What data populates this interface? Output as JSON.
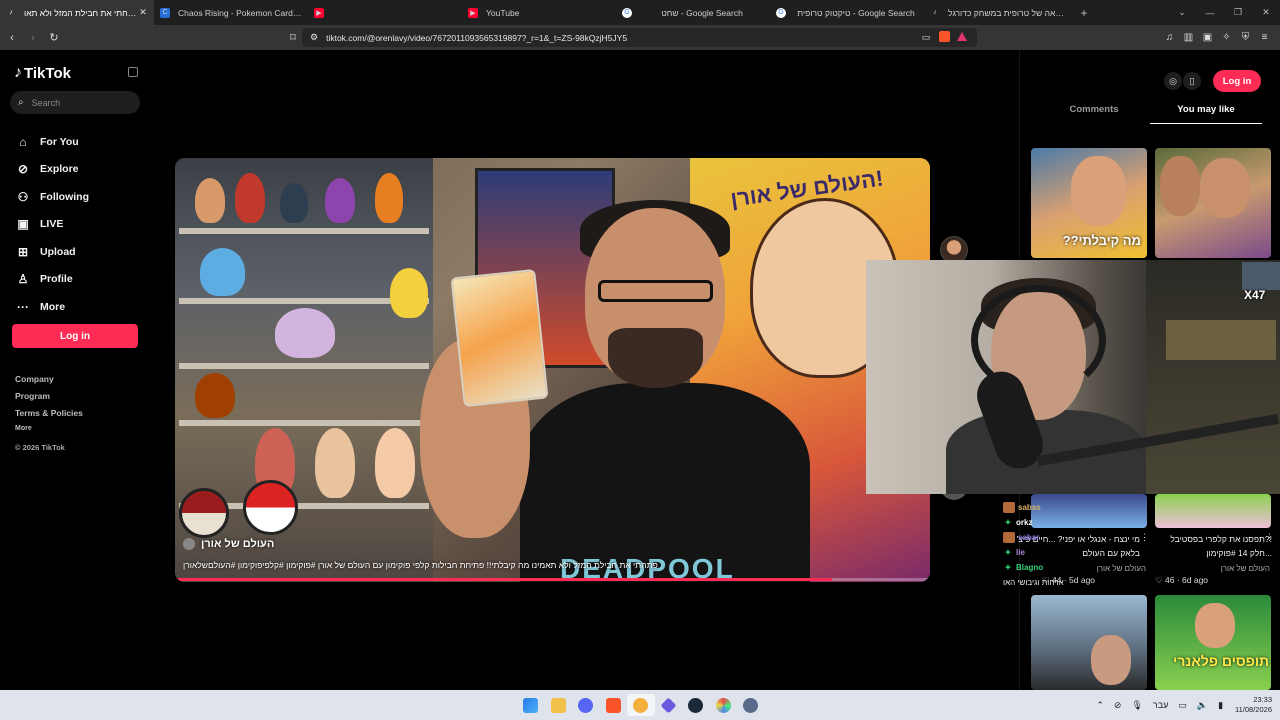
{
  "browser": {
    "tabs": [
      {
        "title": "פתחתי את חבילת המזל ולא תאו",
        "icon": "tiktok-icon",
        "active": true
      },
      {
        "title": "Chaos Rising - Pokemon Card List an",
        "icon": "page-icon",
        "active": false
      },
      {
        "title": "",
        "icon": "youtube-icon",
        "active": false
      },
      {
        "title": "YouTube",
        "icon": "youtube-icon",
        "active": false
      },
      {
        "title": "שחט - Google Search",
        "icon": "google-icon",
        "active": false
      },
      {
        "title": "טיקטוק טרופית - Google Search",
        "icon": "google-icon",
        "active": false
      },
      {
        "title": "ההוצאה של טרופית במשחק כדורגל |",
        "icon": "tiktok-icon",
        "active": false
      }
    ],
    "new_tab": "+",
    "url": "tiktok.com/@orenlavy/video/7672011093565319897?_r=1&_t=ZS-98kQzjH5JY5"
  },
  "sidebar": {
    "brand": "TikTok",
    "search_placeholder": "Search",
    "menu": [
      {
        "label": "For You",
        "icon": "home-icon"
      },
      {
        "label": "Explore",
        "icon": "compass-icon"
      },
      {
        "label": "Following",
        "icon": "people-icon"
      },
      {
        "label": "LIVE",
        "icon": "live-icon"
      },
      {
        "label": "Upload",
        "icon": "plus-square-icon"
      },
      {
        "label": "Profile",
        "icon": "person-icon"
      },
      {
        "label": "More",
        "icon": "more-dots-icon"
      }
    ],
    "login_label": "Log in",
    "footer": [
      "Company",
      "Program",
      "Terms & Policies"
    ],
    "footer_more": "More",
    "copyright": "© 2026 TikTok"
  },
  "video": {
    "author": "העולם של אורן",
    "caption": "פתחתי את חבילת המזל ולא תאמינו מה קיבלתי!! פתיחת חבילות קלפי פוקימון עם העולם של אורן #פוקימון #קלפיפוקימון #העולםשלאורן",
    "poster_text": "העולם של אורן!",
    "shirt_text": "DEADPOOL",
    "progress": 0.87
  },
  "right_panel": {
    "login_label": "Log in",
    "tabs": [
      "Comments",
      "You may like"
    ],
    "active_tab": 1,
    "thumbnails": [
      {
        "overlay": "מה קיבלתי??"
      },
      {
        "overlay": ""
      },
      {
        "title": "מי ינצח - אנגלי או יפני? ...חיים פיצ' בלאק עם העולם",
        "author": "העולם של אורן",
        "likes": "44",
        "age": "5d ago"
      },
      {
        "title": "!?תפסנו את קלפרי בפסטיבל ...חלק 14 #פוקימון",
        "author": "העולם של אורן",
        "likes": "46",
        "age": "6d ago"
      },
      {
        "overlay": ""
      },
      {
        "overlay": "תופסים פלאנרי"
      }
    ]
  },
  "webcam": {
    "badge": "X47"
  },
  "chat": [
    {
      "user": "sabas",
      "badge": ""
    },
    {
      "user": "orkz",
      "badge": "✦"
    },
    {
      "user": "sabar",
      "badge": ""
    },
    {
      "user": "lie",
      "badge": "✦"
    },
    {
      "user": "Blagno",
      "badge": "✦"
    },
    {
      "user": "ארחות וגיבושי האו",
      "badge": ""
    }
  ],
  "taskbar": {
    "tray_lang": "עבר",
    "time": "23:33",
    "date": "11/08/2026"
  }
}
